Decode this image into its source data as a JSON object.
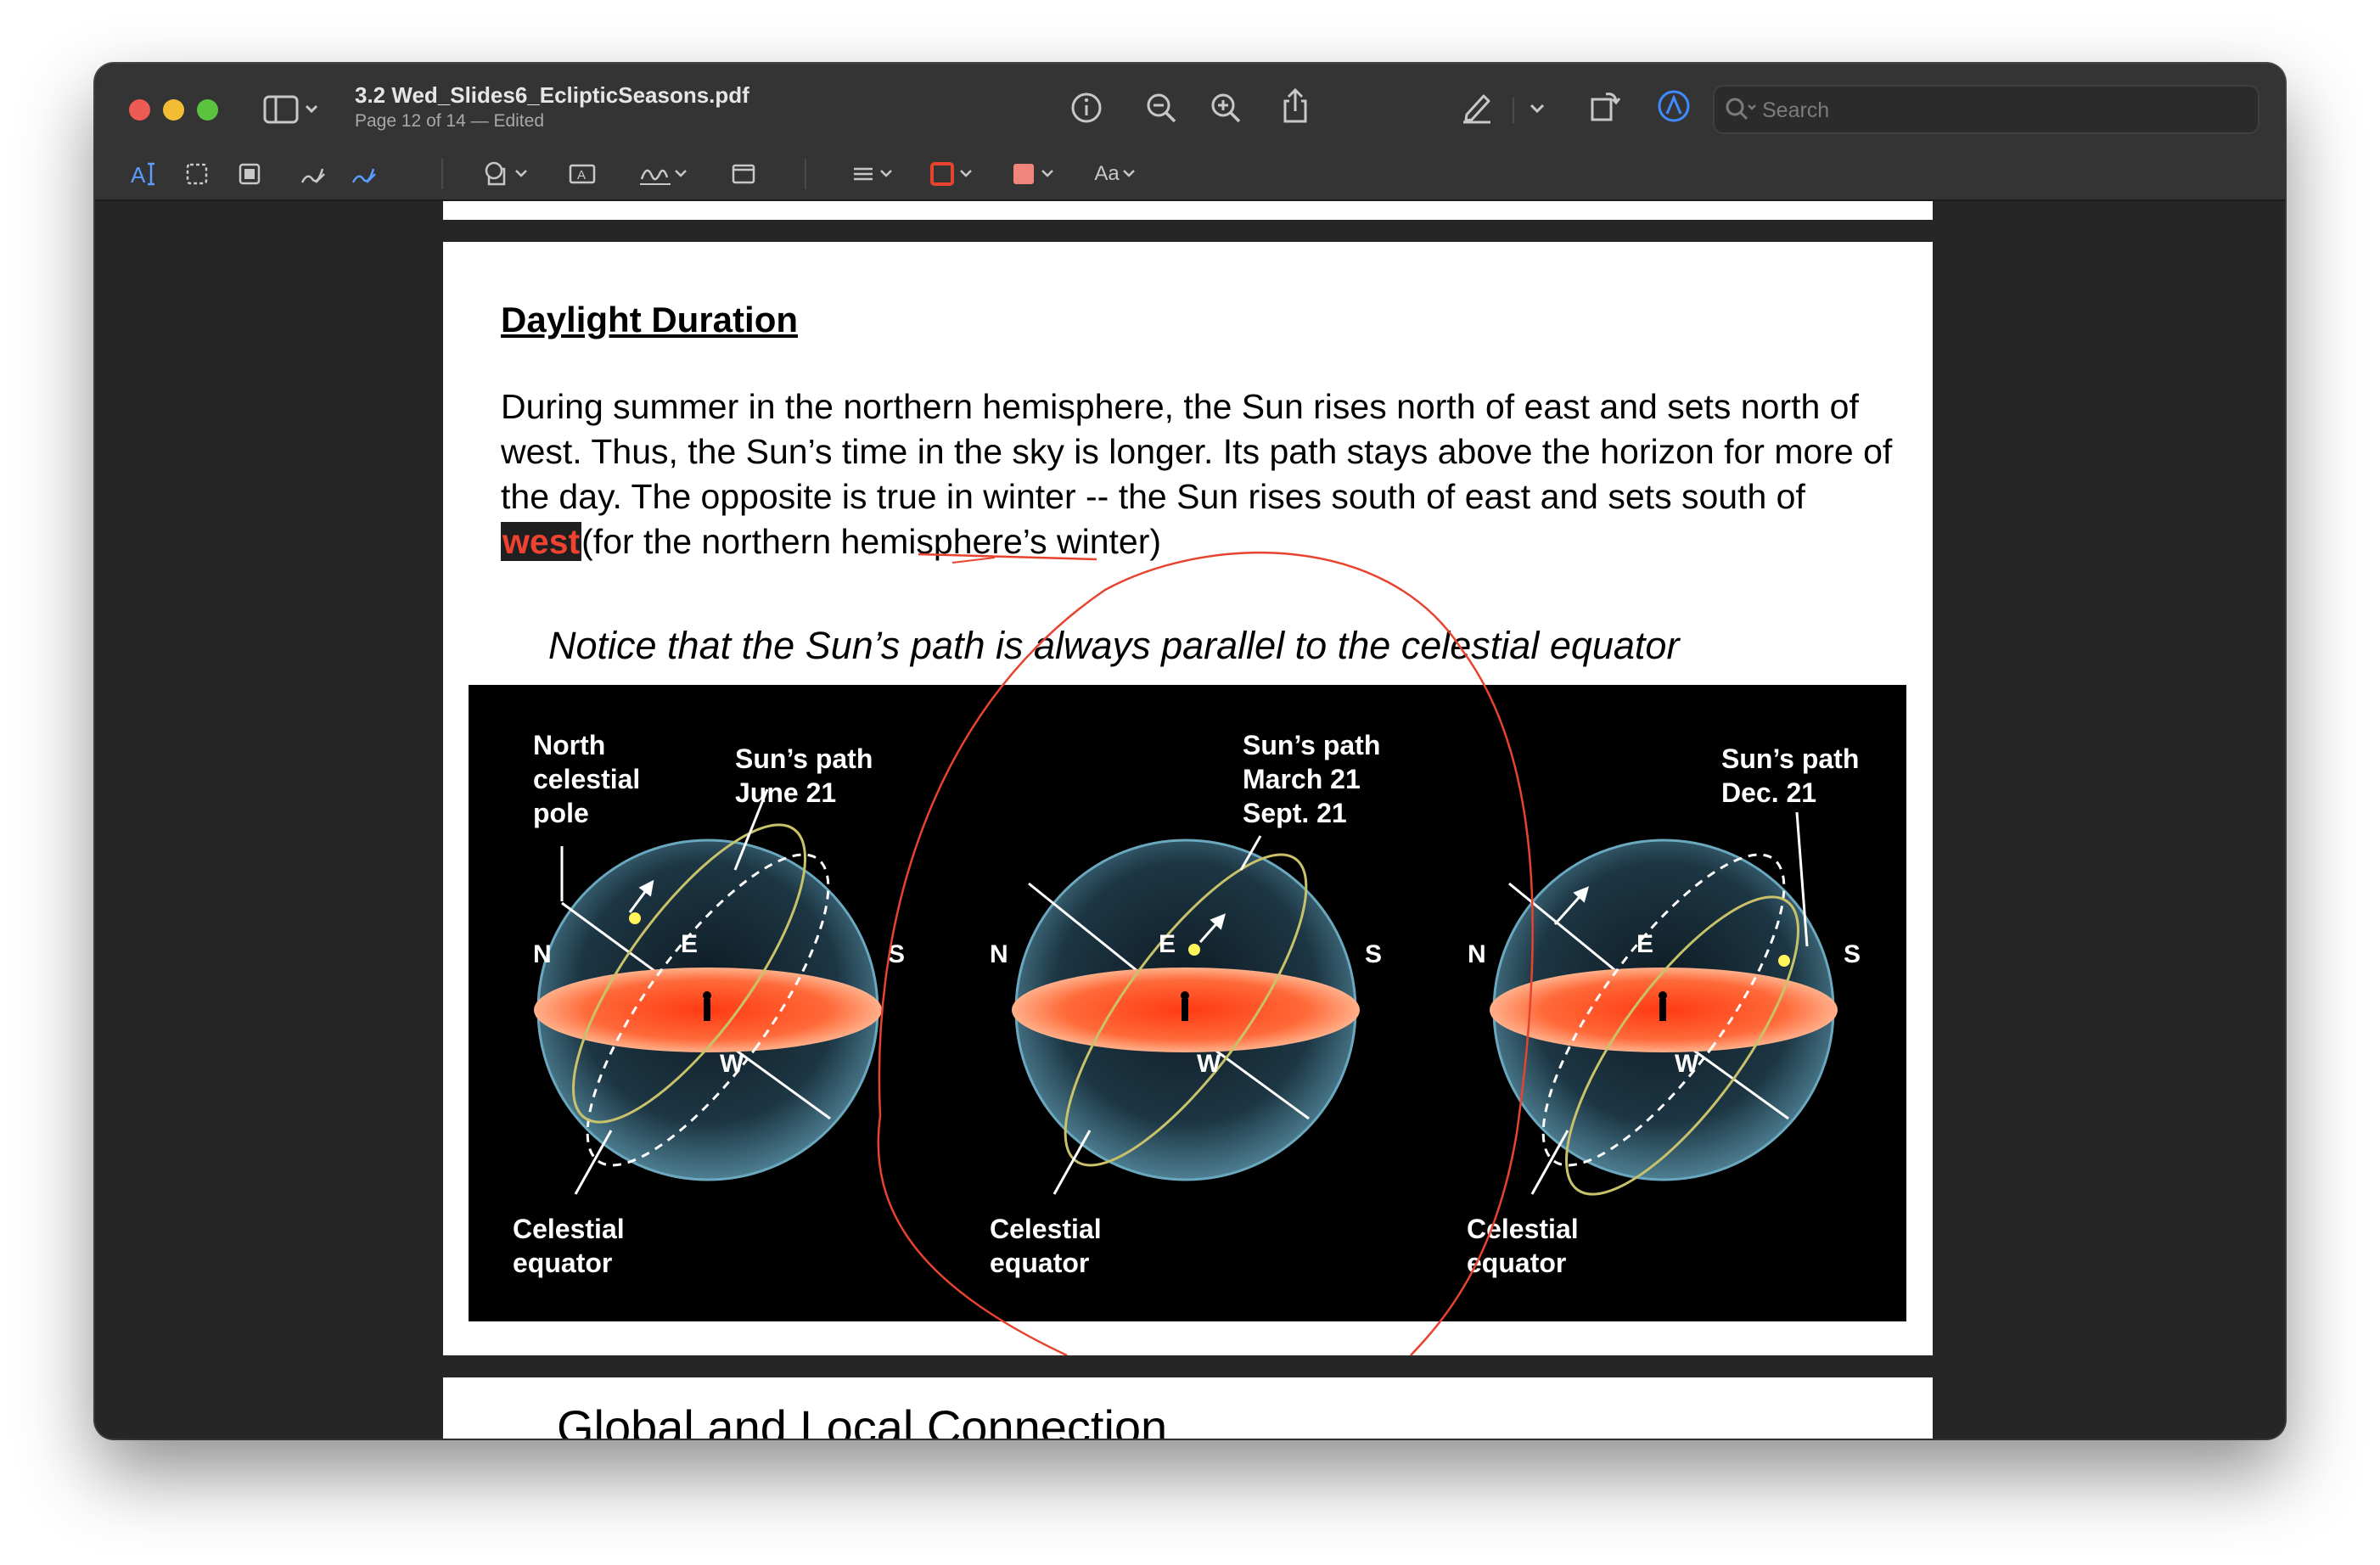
{
  "window": {
    "title": "3.2 Wed_Slides6_EclipticSeasons.pdf",
    "subtitle": "Page 12 of 14 — Edited"
  },
  "toolbar": {
    "search_placeholder": "Search",
    "icons": [
      "sidebar-icon",
      "info-icon",
      "zoom-out-icon",
      "zoom-in-icon",
      "share-icon",
      "highlighter-pen-icon",
      "rotate-icon",
      "markup-icon",
      "redact-icon",
      "search-icon"
    ]
  },
  "markup_toolbar": {
    "text_size_label": "Aa",
    "text_select_label": "A",
    "text_box_label": "A",
    "border_color": "#e8432f",
    "fill_color": "#f2857b"
  },
  "document": {
    "heading": "Daylight Duration",
    "paragraph_before": "During summer in the northern hemisphere, the Sun rises north of east and sets north of west.  Thus, the Sun’s time in the sky is longer.  Its path stays above the horizon for more of the day.  The opposite is true in winter -- the Sun rises south of east and sets south of ",
    "highlighted_word": "west",
    "paragraph_after": "(for the northern hemisphere’s winter)",
    "notice": "Notice that the Sun’s path is always parallel to the celestial equator",
    "next_page_title": "Global and Local Connection"
  },
  "figure": {
    "panel1": {
      "pole_label_1": "North",
      "pole_label_2": "celestial",
      "pole_label_3": "pole",
      "path_label_1": "Sun’s path",
      "path_label_2": "June 21",
      "eq_label_1": "Celestial",
      "eq_label_2": "equator",
      "n": "N",
      "s": "S",
      "e": "E",
      "w": "W"
    },
    "panel2": {
      "path_label_1": "Sun’s path",
      "path_label_2": "March 21",
      "path_label_3": "Sept. 21",
      "eq_label_1": "Celestial",
      "eq_label_2": "equator",
      "n": "N",
      "s": "S",
      "e": "E",
      "w": "W"
    },
    "panel3": {
      "path_label_1": "Sun’s path",
      "path_label_2": "Dec. 21",
      "eq_label_1": "Celestial",
      "eq_label_2": "equator",
      "n": "N",
      "s": "S",
      "e": "E",
      "w": "W"
    }
  },
  "colors": {
    "annotation_red": "#e8432f",
    "horizon_orange": "#ff5a2a",
    "sphere_blue": "#2a4a5a"
  }
}
